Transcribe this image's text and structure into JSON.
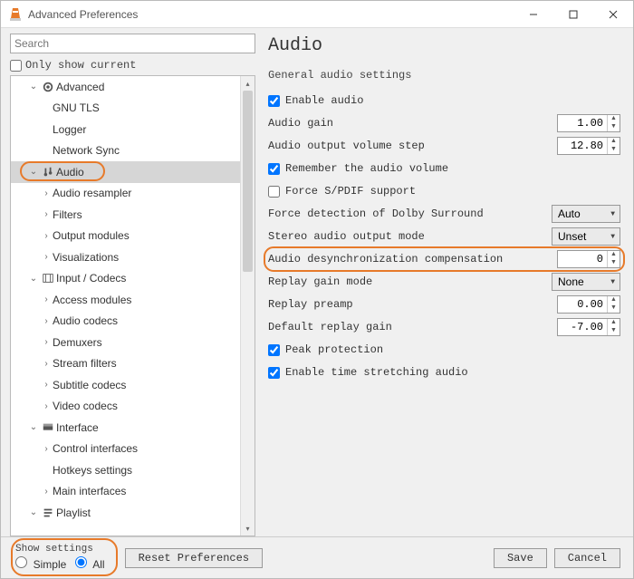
{
  "window": {
    "title": "Advanced Preferences"
  },
  "search": {
    "placeholder": "Search"
  },
  "only_current_label": "Only show current",
  "tree": {
    "advanced": {
      "label": "Advanced",
      "children": [
        "GNU TLS",
        "Logger",
        "Network Sync"
      ]
    },
    "audio": {
      "label": "Audio",
      "children": [
        "Audio resampler",
        "Filters",
        "Output modules",
        "Visualizations"
      ]
    },
    "input": {
      "label": "Input / Codecs",
      "children": [
        "Access modules",
        "Audio codecs",
        "Demuxers",
        "Stream filters",
        "Subtitle codecs",
        "Video codecs"
      ]
    },
    "interface": {
      "label": "Interface",
      "children": [
        "Control interfaces",
        "Hotkeys settings",
        "Main interfaces"
      ]
    },
    "playlist": {
      "label": "Playlist"
    }
  },
  "right": {
    "heading": "Audio",
    "subheading": "General audio settings",
    "enable_audio": "Enable audio",
    "audio_gain": {
      "label": "Audio gain",
      "value": "1.00"
    },
    "volume_step": {
      "label": "Audio output volume step",
      "value": "12.80"
    },
    "remember": "Remember the audio volume",
    "spdif": "Force S/PDIF support",
    "dolby": {
      "label": "Force detection of Dolby Surround",
      "value": "Auto"
    },
    "stereo": {
      "label": "Stereo audio output mode",
      "value": "Unset"
    },
    "desync": {
      "label": "Audio desynchronization compensation",
      "value": "0"
    },
    "replay_mode": {
      "label": "Replay gain mode",
      "value": "None"
    },
    "replay_preamp": {
      "label": "Replay preamp",
      "value": "0.00"
    },
    "default_gain": {
      "label": "Default replay gain",
      "value": "-7.00"
    },
    "peak": "Peak protection",
    "timestretch": "Enable time stretching audio"
  },
  "footer": {
    "show_settings": "Show settings",
    "simple": "Simple",
    "all": "All",
    "reset": "Reset Preferences",
    "save": "Save",
    "cancel": "Cancel"
  }
}
